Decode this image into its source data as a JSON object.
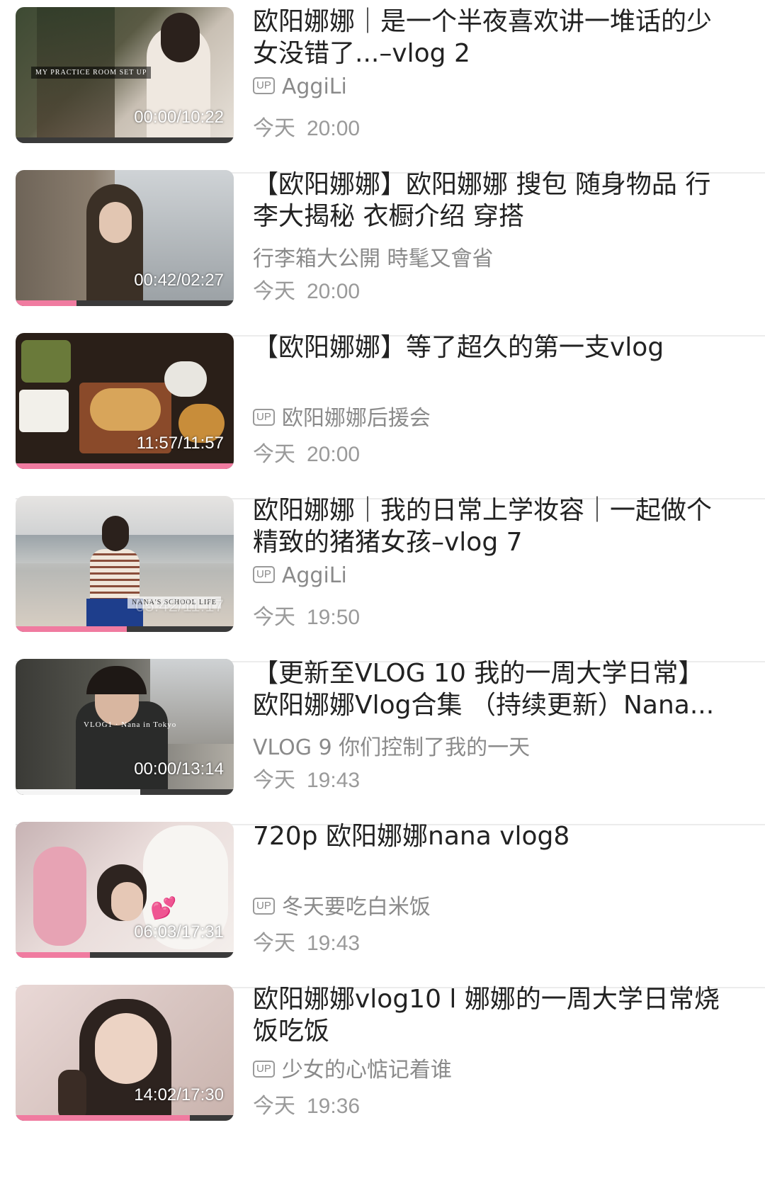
{
  "videos": [
    {
      "title": "欧阳娜娜｜是一个半夜喜欢讲一堆话的少女没错了...–vlog  2",
      "has_up_badge": true,
      "meta": "AggiLi",
      "date": "今天",
      "time": "20:00",
      "duration": "00:00/10:22",
      "overlay_text": "MY PRACTICE ROOM SET UP",
      "progress": 0.0
    },
    {
      "title": "【欧阳娜娜】欧阳娜娜  搜包  随身物品  行李大揭秘  衣橱介绍  穿搭",
      "has_up_badge": false,
      "meta": "行李箱大公開  時髦又會省",
      "date": "今天",
      "time": "20:00",
      "duration": "00:42/02:27",
      "overlay_text": "",
      "progress": 0.28
    },
    {
      "title": "【欧阳娜娜】等了超久的第一支vlog",
      "has_up_badge": true,
      "meta": "欧阳娜娜后援会",
      "date": "今天",
      "time": "20:00",
      "duration": "11:57/11:57",
      "overlay_text": "",
      "progress": 1.0
    },
    {
      "title": "欧阳娜娜｜我的日常上学妆容｜一起做个精致的猪猪女孩–vlog  7",
      "has_up_badge": true,
      "meta": "AggiLi",
      "date": "今天",
      "time": "19:50",
      "duration": "05:42/11:17",
      "overlay_text": "NANA'S SCHOOL LIFE",
      "progress": 0.51
    },
    {
      "title": "【更新至VLOG  10  我的一周大学日常】欧阳娜娜Vlog合集  （持续更新）Nana...",
      "has_up_badge": false,
      "meta": "VLOG  9  你们控制了我的一天",
      "date": "今天",
      "time": "19:43",
      "duration": "00:00/13:14",
      "overlay_text": "VLOG1 · Nana in Tokyo",
      "progress": 0.57
    },
    {
      "title": "720p  欧阳娜娜nana  vlog8",
      "has_up_badge": true,
      "meta": "冬天要吃白米饭",
      "date": "今天",
      "time": "19:43",
      "duration": "06:03/17:31",
      "overlay_text": "",
      "progress": 0.34
    },
    {
      "title": "欧阳娜娜vlog10  l  娜娜的一周大学日常烧饭吃饭",
      "has_up_badge": true,
      "meta": "少女的心惦记着谁",
      "date": "今天",
      "time": "19:36",
      "duration": "14:02/17:30",
      "overlay_text": "",
      "progress": 0.8
    }
  ],
  "up_badge_text": "UP",
  "colors": {
    "progress": "#f07ba0",
    "meta": "#8a8a8a",
    "title": "#222222"
  }
}
